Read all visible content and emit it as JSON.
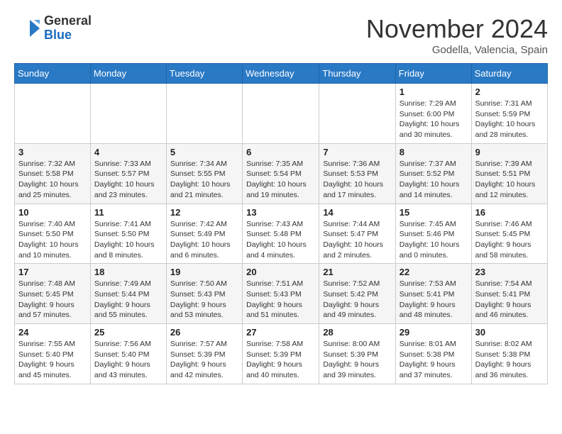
{
  "header": {
    "logo_general": "General",
    "logo_blue": "Blue",
    "month_title": "November 2024",
    "location": "Godella, Valencia, Spain"
  },
  "days_of_week": [
    "Sunday",
    "Monday",
    "Tuesday",
    "Wednesday",
    "Thursday",
    "Friday",
    "Saturday"
  ],
  "weeks": [
    [
      {
        "day": "",
        "info": ""
      },
      {
        "day": "",
        "info": ""
      },
      {
        "day": "",
        "info": ""
      },
      {
        "day": "",
        "info": ""
      },
      {
        "day": "",
        "info": ""
      },
      {
        "day": "1",
        "info": "Sunrise: 7:29 AM\nSunset: 6:00 PM\nDaylight: 10 hours and 30 minutes."
      },
      {
        "day": "2",
        "info": "Sunrise: 7:31 AM\nSunset: 5:59 PM\nDaylight: 10 hours and 28 minutes."
      }
    ],
    [
      {
        "day": "3",
        "info": "Sunrise: 7:32 AM\nSunset: 5:58 PM\nDaylight: 10 hours and 25 minutes."
      },
      {
        "day": "4",
        "info": "Sunrise: 7:33 AM\nSunset: 5:57 PM\nDaylight: 10 hours and 23 minutes."
      },
      {
        "day": "5",
        "info": "Sunrise: 7:34 AM\nSunset: 5:55 PM\nDaylight: 10 hours and 21 minutes."
      },
      {
        "day": "6",
        "info": "Sunrise: 7:35 AM\nSunset: 5:54 PM\nDaylight: 10 hours and 19 minutes."
      },
      {
        "day": "7",
        "info": "Sunrise: 7:36 AM\nSunset: 5:53 PM\nDaylight: 10 hours and 17 minutes."
      },
      {
        "day": "8",
        "info": "Sunrise: 7:37 AM\nSunset: 5:52 PM\nDaylight: 10 hours and 14 minutes."
      },
      {
        "day": "9",
        "info": "Sunrise: 7:39 AM\nSunset: 5:51 PM\nDaylight: 10 hours and 12 minutes."
      }
    ],
    [
      {
        "day": "10",
        "info": "Sunrise: 7:40 AM\nSunset: 5:50 PM\nDaylight: 10 hours and 10 minutes."
      },
      {
        "day": "11",
        "info": "Sunrise: 7:41 AM\nSunset: 5:50 PM\nDaylight: 10 hours and 8 minutes."
      },
      {
        "day": "12",
        "info": "Sunrise: 7:42 AM\nSunset: 5:49 PM\nDaylight: 10 hours and 6 minutes."
      },
      {
        "day": "13",
        "info": "Sunrise: 7:43 AM\nSunset: 5:48 PM\nDaylight: 10 hours and 4 minutes."
      },
      {
        "day": "14",
        "info": "Sunrise: 7:44 AM\nSunset: 5:47 PM\nDaylight: 10 hours and 2 minutes."
      },
      {
        "day": "15",
        "info": "Sunrise: 7:45 AM\nSunset: 5:46 PM\nDaylight: 10 hours and 0 minutes."
      },
      {
        "day": "16",
        "info": "Sunrise: 7:46 AM\nSunset: 5:45 PM\nDaylight: 9 hours and 58 minutes."
      }
    ],
    [
      {
        "day": "17",
        "info": "Sunrise: 7:48 AM\nSunset: 5:45 PM\nDaylight: 9 hours and 57 minutes."
      },
      {
        "day": "18",
        "info": "Sunrise: 7:49 AM\nSunset: 5:44 PM\nDaylight: 9 hours and 55 minutes."
      },
      {
        "day": "19",
        "info": "Sunrise: 7:50 AM\nSunset: 5:43 PM\nDaylight: 9 hours and 53 minutes."
      },
      {
        "day": "20",
        "info": "Sunrise: 7:51 AM\nSunset: 5:43 PM\nDaylight: 9 hours and 51 minutes."
      },
      {
        "day": "21",
        "info": "Sunrise: 7:52 AM\nSunset: 5:42 PM\nDaylight: 9 hours and 49 minutes."
      },
      {
        "day": "22",
        "info": "Sunrise: 7:53 AM\nSunset: 5:41 PM\nDaylight: 9 hours and 48 minutes."
      },
      {
        "day": "23",
        "info": "Sunrise: 7:54 AM\nSunset: 5:41 PM\nDaylight: 9 hours and 46 minutes."
      }
    ],
    [
      {
        "day": "24",
        "info": "Sunrise: 7:55 AM\nSunset: 5:40 PM\nDaylight: 9 hours and 45 minutes."
      },
      {
        "day": "25",
        "info": "Sunrise: 7:56 AM\nSunset: 5:40 PM\nDaylight: 9 hours and 43 minutes."
      },
      {
        "day": "26",
        "info": "Sunrise: 7:57 AM\nSunset: 5:39 PM\nDaylight: 9 hours and 42 minutes."
      },
      {
        "day": "27",
        "info": "Sunrise: 7:58 AM\nSunset: 5:39 PM\nDaylight: 9 hours and 40 minutes."
      },
      {
        "day": "28",
        "info": "Sunrise: 8:00 AM\nSunset: 5:39 PM\nDaylight: 9 hours and 39 minutes."
      },
      {
        "day": "29",
        "info": "Sunrise: 8:01 AM\nSunset: 5:38 PM\nDaylight: 9 hours and 37 minutes."
      },
      {
        "day": "30",
        "info": "Sunrise: 8:02 AM\nSunset: 5:38 PM\nDaylight: 9 hours and 36 minutes."
      }
    ]
  ]
}
